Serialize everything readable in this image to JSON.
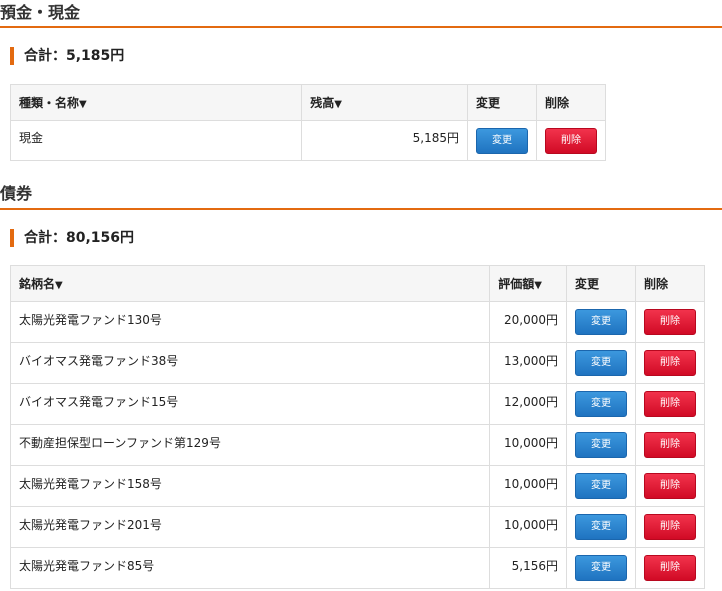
{
  "deposits": {
    "title": "預金・現金",
    "total_label": "合計：5,185円",
    "headers": {
      "name": "種類・名称",
      "balance": "残高",
      "change": "変更",
      "delete": "削除"
    },
    "rows": [
      {
        "name": "現金",
        "amount": "5,185円"
      }
    ],
    "change_btn": "変更",
    "delete_btn": "削除"
  },
  "bonds": {
    "title": "債券",
    "total_label": "合計：80,156円",
    "headers": {
      "name": "銘柄名",
      "value": "評価額",
      "change": "変更",
      "delete": "削除"
    },
    "rows": [
      {
        "name": "太陽光発電ファンド130号",
        "amount": "20,000円"
      },
      {
        "name": "バイオマス発電ファンド38号",
        "amount": "13,000円"
      },
      {
        "name": "バイオマス発電ファンド15号",
        "amount": "12,000円"
      },
      {
        "name": "不動産担保型ローンファンド第129号",
        "amount": "10,000円"
      },
      {
        "name": "太陽光発電ファンド158号",
        "amount": "10,000円"
      },
      {
        "name": "太陽光発電ファンド201号",
        "amount": "10,000円"
      },
      {
        "name": "太陽光発電ファンド85号",
        "amount": "5,156円"
      }
    ],
    "change_btn": "変更",
    "delete_btn": "削除"
  },
  "sort_icon": "▼",
  "colors": {
    "accent": "#e36a10",
    "button_blue": "#1f73c0",
    "button_red": "#d10a25"
  }
}
